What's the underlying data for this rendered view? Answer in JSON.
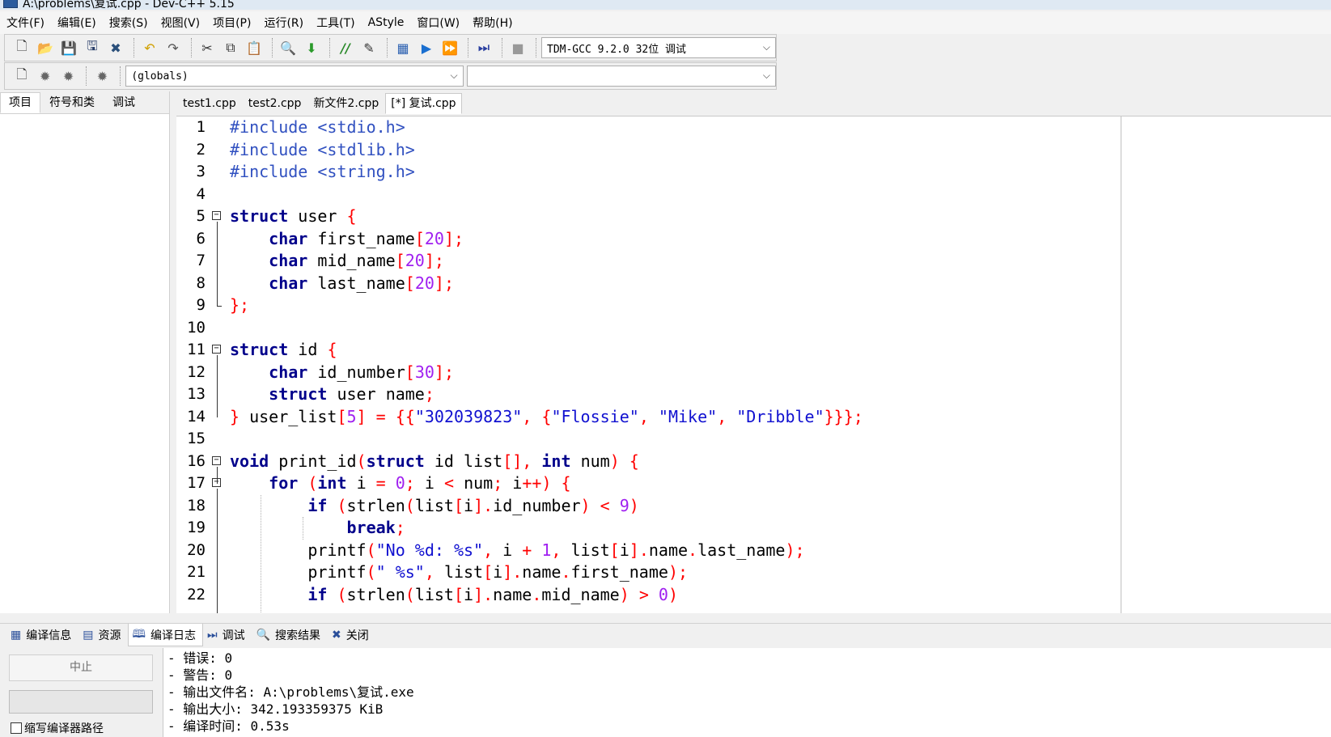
{
  "window": {
    "title": "A:\\problems\\复试.cpp - Dev-C++ 5.15"
  },
  "menu": [
    "文件(F)",
    "编辑(E)",
    "搜索(S)",
    "视图(V)",
    "项目(P)",
    "运行(R)",
    "工具(T)",
    "AStyle",
    "窗口(W)",
    "帮助(H)"
  ],
  "toolbar": {
    "compiler_select": "TDM-GCC 9.2.0 32位 调试",
    "scope_select": "(globals)",
    "member_select": ""
  },
  "left_panel": {
    "tabs": [
      "项目",
      "符号和类",
      "调试"
    ]
  },
  "editor_tabs": [
    "test1.cpp",
    "test2.cpp",
    "新文件2.cpp",
    "[*] 复试.cpp"
  ],
  "code_lines": [
    "#include <stdio.h>",
    "#include <stdlib.h>",
    "#include <string.h>",
    "",
    "struct user {",
    "    char first_name[20];",
    "    char mid_name[20];",
    "    char last_name[20];",
    "};",
    "",
    "struct id {",
    "    char id_number[30];",
    "    struct user name;",
    "} user_list[5] = {{\"302039823\", {\"Flossie\", \"Mike\", \"Dribble\"}}};",
    "",
    "void print_id(struct id list[], int num) {",
    "    for (int i = 0; i < num; i++) {",
    "        if (strlen(list[i].id_number) < 9)",
    "            break;",
    "        printf(\"No %d: %s\", i + 1, list[i].name.last_name);",
    "        printf(\" %s\", list[i].name.first_name);",
    "        if (strlen(list[i].name.mid_name) > 0)"
  ],
  "line_numbers": [
    "1",
    "2",
    "3",
    "4",
    "5",
    "6",
    "7",
    "8",
    "9",
    "10",
    "11",
    "12",
    "13",
    "14",
    "15",
    "16",
    "17",
    "18",
    "19",
    "20",
    "21",
    "22"
  ],
  "bottom_tabs": [
    "编译信息",
    "资源",
    "编译日志",
    "调试",
    "搜索结果",
    "关闭"
  ],
  "bottom_left": {
    "abort_button": "中止",
    "checkbox_label": "缩写编译器路径"
  },
  "compile_log": [
    "- 错误: 0",
    "- 警告: 0",
    "- 输出文件名: A:\\problems\\复试.exe",
    "- 输出大小: 342.193359375 KiB",
    "- 编译时间: 0.53s"
  ]
}
